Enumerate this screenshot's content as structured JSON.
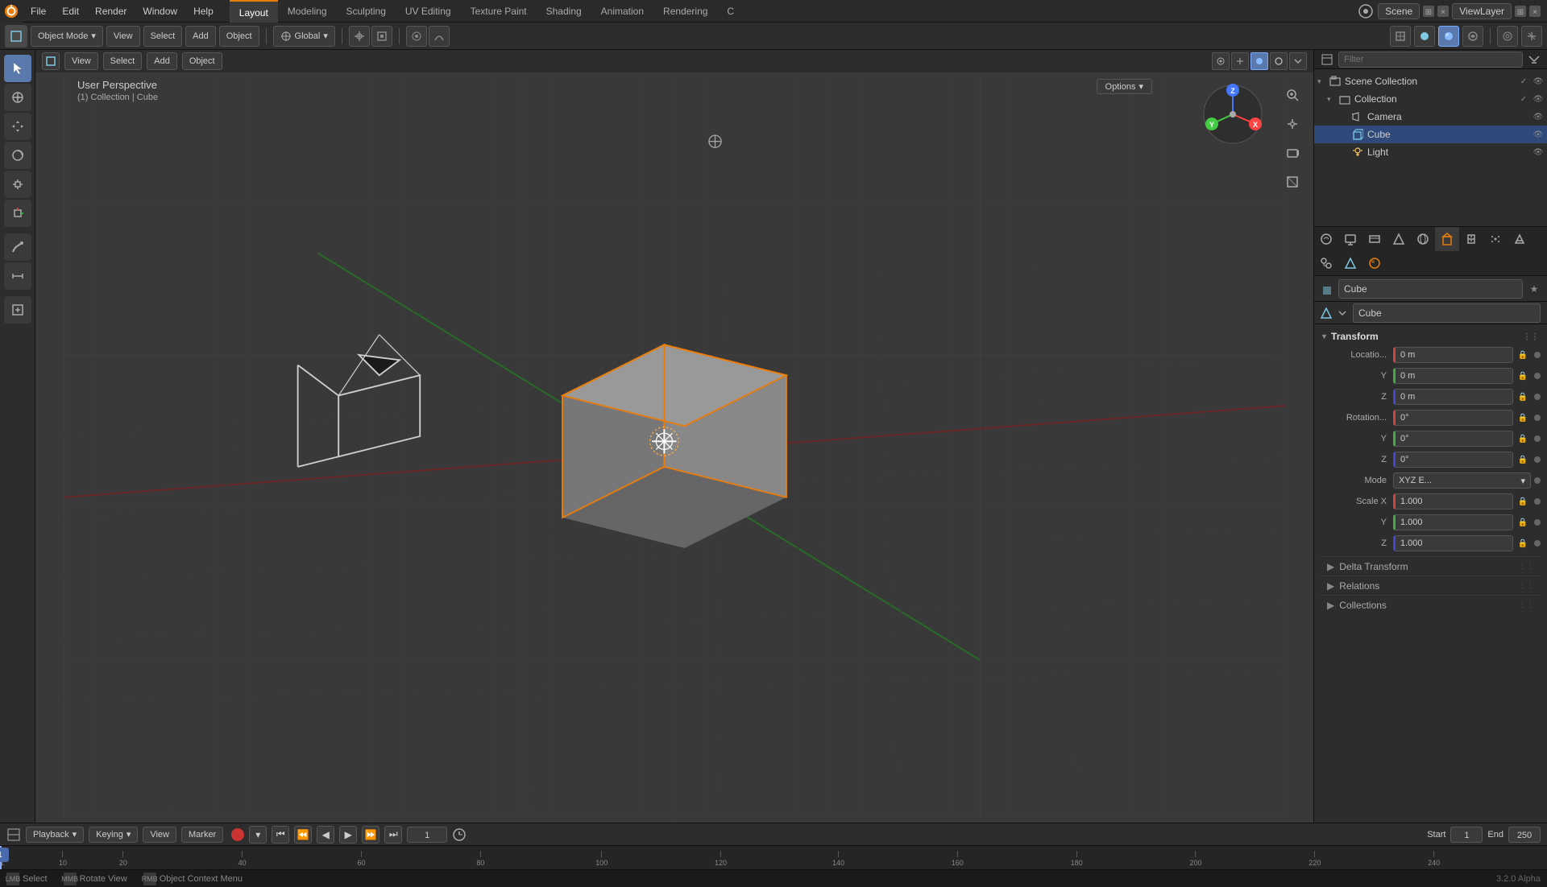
{
  "app": {
    "title": "Blender 3.2.0 Alpha",
    "version": "3.2.0 Alpha"
  },
  "top_menu": {
    "items": [
      "File",
      "Edit",
      "Render",
      "Window",
      "Help"
    ]
  },
  "workspace_tabs": {
    "tabs": [
      "Layout",
      "Modeling",
      "Sculpting",
      "UV Editing",
      "Texture Paint",
      "Shading",
      "Animation",
      "Rendering",
      "C"
    ]
  },
  "top_right": {
    "scene": "Scene",
    "view_layer": "ViewLayer"
  },
  "toolbar": {
    "mode": "Object Mode",
    "view": "View",
    "select": "Select",
    "add": "Add",
    "object": "Object",
    "transform": "Global",
    "options": "Options"
  },
  "viewport": {
    "perspective_label": "User Perspective",
    "collection_label": "(1) Collection | Cube"
  },
  "outliner": {
    "title": "Scene Collection",
    "items": [
      {
        "id": "scene-collection",
        "label": "Scene Collection",
        "level": 0,
        "type": "scene",
        "icon": "▾",
        "expanded": true
      },
      {
        "id": "collection",
        "label": "Collection",
        "level": 1,
        "type": "collection",
        "icon": "▾",
        "expanded": true
      },
      {
        "id": "camera",
        "label": "Camera",
        "level": 2,
        "type": "camera",
        "icon": "📷",
        "active": false
      },
      {
        "id": "cube",
        "label": "Cube",
        "level": 2,
        "type": "mesh",
        "icon": "■",
        "active": true
      },
      {
        "id": "light",
        "label": "Light",
        "level": 2,
        "type": "light",
        "icon": "●",
        "active": false
      }
    ]
  },
  "properties": {
    "object_name": "Cube",
    "mesh_name": "Cube",
    "sections": {
      "transform": {
        "label": "Transform",
        "location": {
          "x": "0 m",
          "y": "0 m",
          "z": "0 m"
        },
        "rotation": {
          "x": "0°",
          "y": "0°",
          "z": "0°"
        },
        "rotation_mode": "XYZ E...",
        "scale": {
          "x": "1.000",
          "y": "1.000",
          "z": "1.000"
        }
      },
      "delta_transform": {
        "label": "Delta Transform",
        "collapsed": true
      },
      "relations": {
        "label": "Relations",
        "collapsed": true
      },
      "collections": {
        "label": "Collections",
        "collapsed": true
      }
    }
  },
  "timeline": {
    "playback": "Playback",
    "keying": "Keying",
    "view": "View",
    "marker": "Marker",
    "current_frame": "1",
    "start_frame": "1",
    "end_frame": "250"
  },
  "timeline_markers": [
    {
      "value": "1",
      "pos_pct": 0
    },
    {
      "value": "10",
      "pos_pct": 3.8
    },
    {
      "value": "20",
      "pos_pct": 7.7
    },
    {
      "value": "40",
      "pos_pct": 15.4
    },
    {
      "value": "60",
      "pos_pct": 23.1
    },
    {
      "value": "80",
      "pos_pct": 30.8
    },
    {
      "value": "100",
      "pos_pct": 38.5
    },
    {
      "value": "120",
      "pos_pct": 46.2
    },
    {
      "value": "140",
      "pos_pct": 53.8
    },
    {
      "value": "160",
      "pos_pct": 61.5
    },
    {
      "value": "180",
      "pos_pct": 69.2
    },
    {
      "value": "200",
      "pos_pct": 76.9
    },
    {
      "value": "220",
      "pos_pct": 84.6
    },
    {
      "value": "240",
      "pos_pct": 92.3
    }
  ],
  "status_bar": {
    "select": "Select",
    "rotate_view": "Rotate View",
    "context_menu": "Object Context Menu"
  },
  "prop_icons": [
    {
      "id": "render",
      "symbol": "📷",
      "active": false
    },
    {
      "id": "output",
      "symbol": "🖨",
      "active": false
    },
    {
      "id": "view",
      "symbol": "👁",
      "active": false
    },
    {
      "id": "scene",
      "symbol": "🎬",
      "active": false
    },
    {
      "id": "world",
      "symbol": "🌐",
      "active": false
    },
    {
      "id": "object",
      "symbol": "■",
      "active": true
    },
    {
      "id": "modifier",
      "symbol": "🔧",
      "active": false
    },
    {
      "id": "particles",
      "symbol": "✦",
      "active": false
    },
    {
      "id": "physics",
      "symbol": "⚙",
      "active": false
    },
    {
      "id": "constraints",
      "symbol": "🔗",
      "active": false
    },
    {
      "id": "data",
      "symbol": "△",
      "active": false
    },
    {
      "id": "material",
      "symbol": "◉",
      "active": false
    }
  ]
}
